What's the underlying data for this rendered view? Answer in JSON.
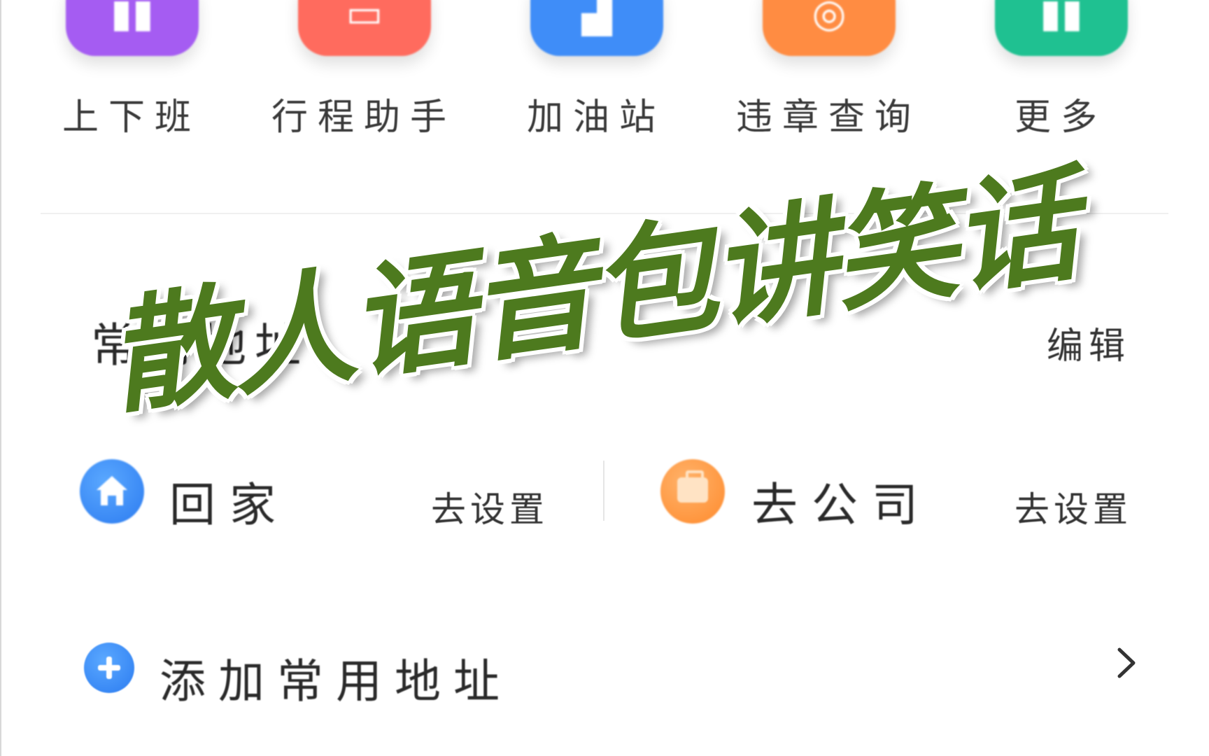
{
  "quick_actions": [
    {
      "label": "上下班",
      "icon": "commute-icon",
      "color": "#a55cf2",
      "glyph": "▮▮"
    },
    {
      "label": "行程助手",
      "icon": "itinerary-icon",
      "color": "#ff6b5e",
      "glyph": "▭"
    },
    {
      "label": "加油站",
      "icon": "gas-station-icon",
      "color": "#3f8df8",
      "glyph": "▟"
    },
    {
      "label": "违章查询",
      "icon": "violation-search-icon",
      "color": "#ff8c42",
      "glyph": "◎"
    },
    {
      "label": "更多",
      "icon": "more-icon",
      "color": "#1fc191",
      "glyph": "▮▮"
    }
  ],
  "frequent": {
    "title": "常用地址",
    "edit_label": "编辑",
    "home": {
      "name": "回家",
      "action": "去设置",
      "icon": "home-icon"
    },
    "work": {
      "name": "去公司",
      "action": "去设置",
      "icon": "briefcase-icon"
    },
    "add_label": "添加常用地址"
  },
  "overlay_caption": "散人语音包讲笑话"
}
